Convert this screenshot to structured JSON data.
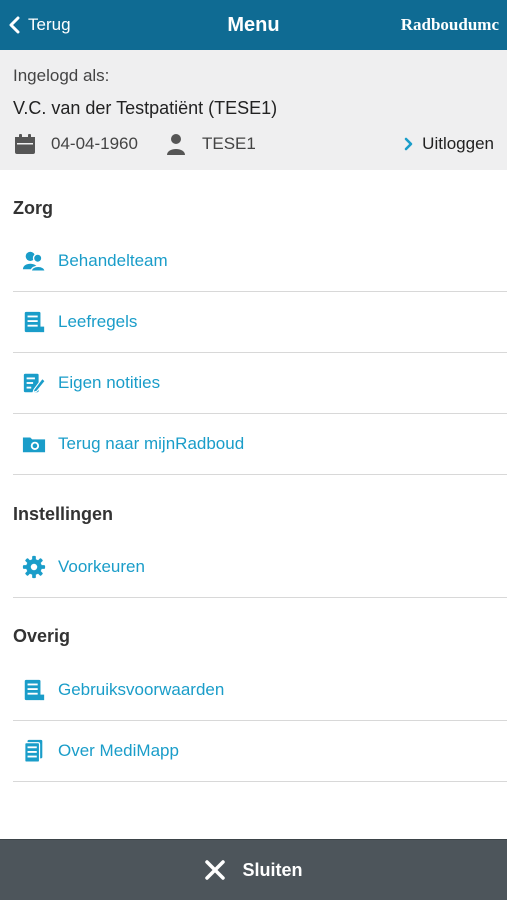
{
  "header": {
    "back_label": "Terug",
    "title": "Menu",
    "brand": "Radboudumc"
  },
  "user": {
    "logged_in_label": "Ingelogd als:",
    "name": "V.C. van der Testpatiënt (TESE1)",
    "dob": "04-04-1960",
    "user_id": "TESE1",
    "logout_label": "Uitloggen"
  },
  "sections": {
    "zorg": "Zorg",
    "instellingen": "Instellingen",
    "overig": "Overig"
  },
  "items": {
    "behandelteam": "Behandelteam",
    "leefregels": "Leefregels",
    "notities": "Eigen notities",
    "mijnradboud": "Terug naar mijnRadboud",
    "voorkeuren": "Voorkeuren",
    "voorwaarden": "Gebruiksvoorwaarden",
    "over": "Over MediMapp"
  },
  "footer": {
    "close_label": "Sluiten"
  },
  "colors": {
    "header_bg": "#0f6b93",
    "accent": "#1a9dc9",
    "footer_bg": "#4d555b",
    "user_panel_bg": "#efeff0"
  }
}
